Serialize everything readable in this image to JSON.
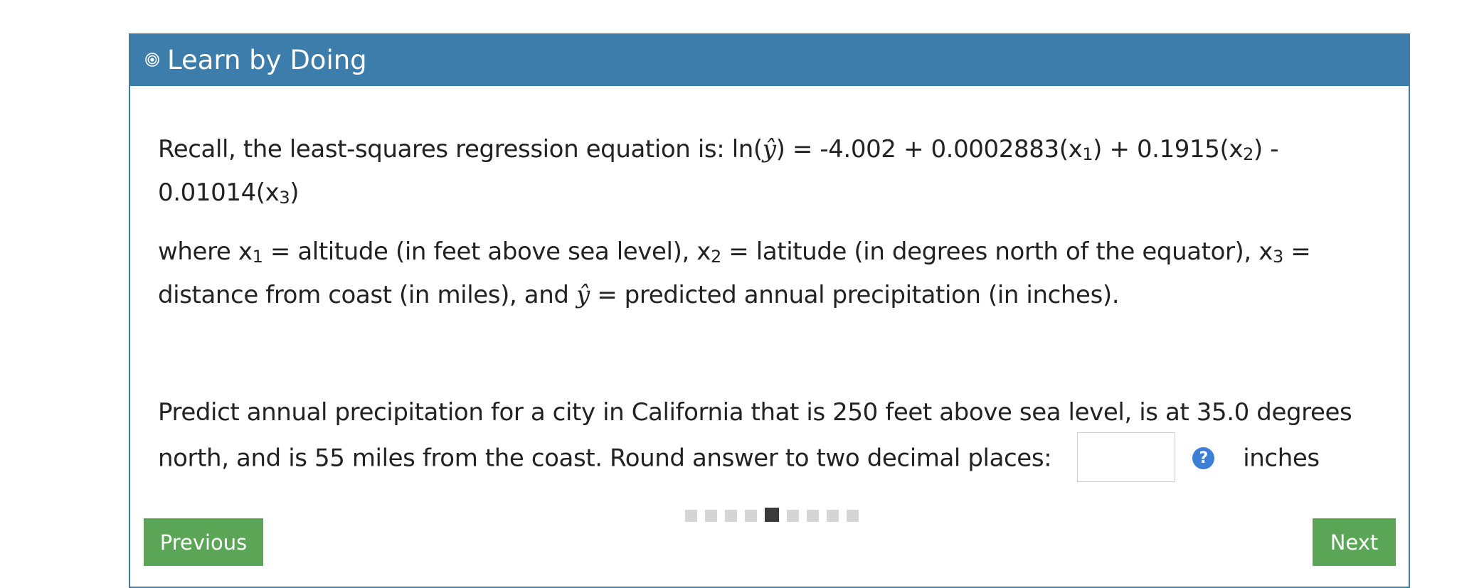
{
  "header": {
    "title": "Learn by Doing",
    "icon": "target-icon",
    "color": "#3d7dab"
  },
  "content": {
    "paragraph1": {
      "intro": "Recall, the least-squares regression equation is: ",
      "ln_open": "ln(",
      "yhat": "ŷ",
      "eq_part1": ") = -4.002 + 0.0002883(x",
      "sub1": "1",
      "eq_part2": ") + 0.1915(x",
      "sub2": "2",
      "eq_part3": ") - 0.01014(x",
      "sub3": "3",
      "eq_part4": ")"
    },
    "paragraph2": {
      "where_x": "where x",
      "sub1": "1",
      "alt": " = altitude (in feet above sea level), x",
      "sub2": "2",
      "lat": " = latitude (in degrees north of the equator), x",
      "sub3": "3",
      "dist": " = distance from coast (in miles), and ",
      "yhat": "ŷ",
      "pred": " = predicted annual precipitation (in inches)."
    },
    "question": {
      "text": "Predict annual precipitation for a city in California that is 250 feet above sea level, is at 35.0 degrees north, and is 55 miles from the coast. Round answer to two decimal places:",
      "answer_value": "",
      "help_label": "?",
      "unit": "inches"
    }
  },
  "pager": {
    "total": 9,
    "current": 5
  },
  "buttons": {
    "previous": "Previous",
    "next": "Next",
    "color": "#5aa656"
  }
}
